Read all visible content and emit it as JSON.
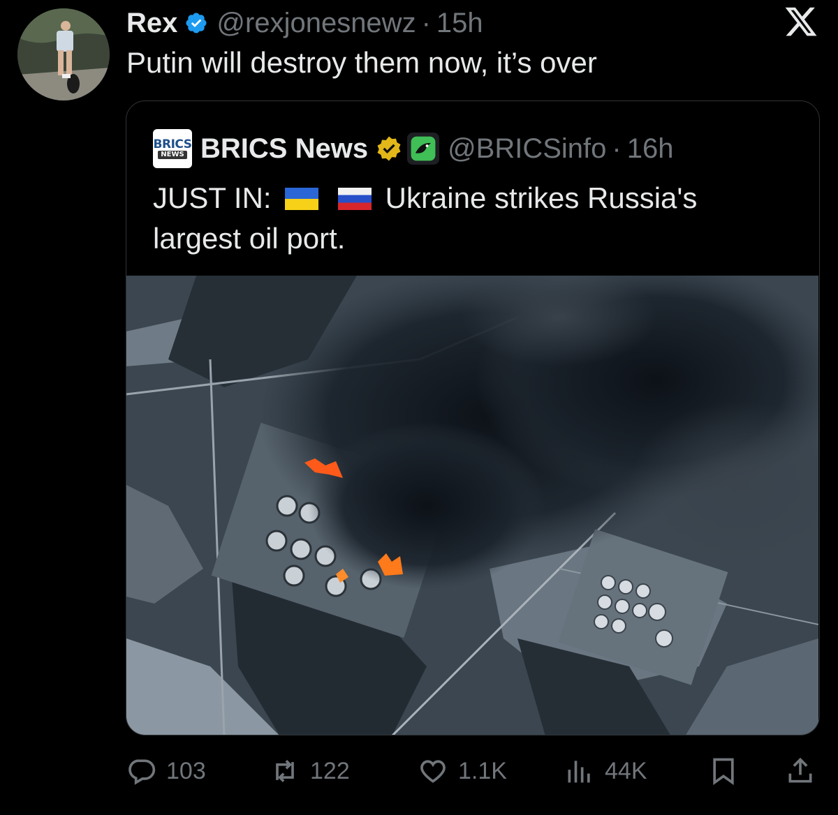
{
  "post": {
    "author_name": "Rex",
    "handle": "@rexjonesnewz",
    "separator": "·",
    "time": "15h",
    "text": "Putin will destroy them now, it’s over",
    "verified_color": "#1d9bf0"
  },
  "quote": {
    "logo_text_top": "BRICS",
    "logo_text_bottom": "NEWS",
    "author_name": "BRICS News",
    "handle": "@BRICSinfo",
    "separator": "·",
    "time": "16h",
    "text_prefix": "JUST IN:",
    "flags": [
      "Ukraine flag",
      "Russia flag"
    ],
    "text_suffix": "Ukraine strikes Russia's largest oil port.",
    "badge_color": "#e2b719",
    "media": "satellite-image-oil-port-smoke"
  },
  "actions": {
    "replies": "103",
    "reposts": "122",
    "likes": "1.1K",
    "views": "44K"
  },
  "icons": [
    "verified-badge-icon",
    "x-logo-icon",
    "gold-verified-icon",
    "affiliate-badge-icon",
    "reply-icon",
    "repost-icon",
    "like-icon",
    "views-icon",
    "bookmark-icon",
    "share-icon"
  ]
}
